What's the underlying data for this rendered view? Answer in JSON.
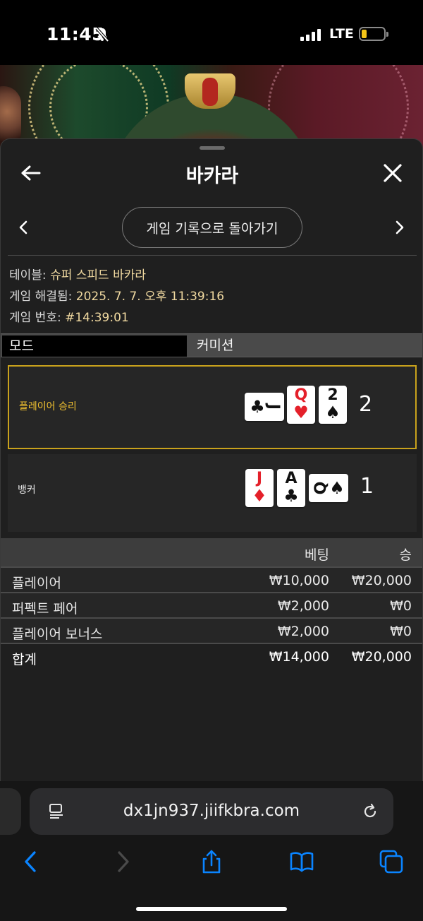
{
  "status_bar": {
    "time": "11:45",
    "network": "LTE"
  },
  "sheet": {
    "title": "바카라",
    "back_to_history": "게임 기록으로 돌아가기"
  },
  "info": {
    "table_label": "테이블:",
    "table_value": "슈퍼 스피드 바카라",
    "resolved_label": "게임 해결됨:",
    "resolved_value": "2025. 7. 7. 오후 11:39:16",
    "game_no_label": "게임 번호:",
    "game_no_value": "#14:39:01"
  },
  "mode": {
    "label": "모드",
    "value": "커미션"
  },
  "player": {
    "label": "플레이어 승리",
    "score": "2",
    "cards": [
      {
        "rank": "J",
        "suit": "♣",
        "color": "#111111",
        "orientation": "sideways"
      },
      {
        "rank": "Q",
        "suit": "♥",
        "color": "#e4202a",
        "orientation": "upright"
      },
      {
        "rank": "2",
        "suit": "♠",
        "color": "#111111",
        "orientation": "upright"
      }
    ]
  },
  "banker": {
    "label": "뱅커",
    "score": "1",
    "cards": [
      {
        "rank": "J",
        "suit": "♦",
        "color": "#e4202a",
        "orientation": "upright"
      },
      {
        "rank": "A",
        "suit": "♣",
        "color": "#111111",
        "orientation": "upright"
      },
      {
        "rank": "Q",
        "suit": "♠",
        "color": "#111111",
        "orientation": "sideways"
      }
    ]
  },
  "bets": {
    "headers": {
      "bet": "베팅",
      "win": "승"
    },
    "rows": [
      {
        "label": "플레이어",
        "bet": "₩10,000",
        "win": "₩20,000"
      },
      {
        "label": "퍼펙트 페어",
        "bet": "₩2,000",
        "win": "₩0"
      },
      {
        "label": "플레이어 보너스",
        "bet": "₩2,000",
        "win": "₩0"
      }
    ],
    "total": {
      "label": "합계",
      "bet": "₩14,000",
      "win": "₩20,000"
    }
  },
  "browser": {
    "url": "dx1jn937.jiifkbra.com",
    "accent": "#0a84ff"
  },
  "colors": {
    "highlight": "#c9a21c",
    "info_value": "#f0d9a0"
  }
}
